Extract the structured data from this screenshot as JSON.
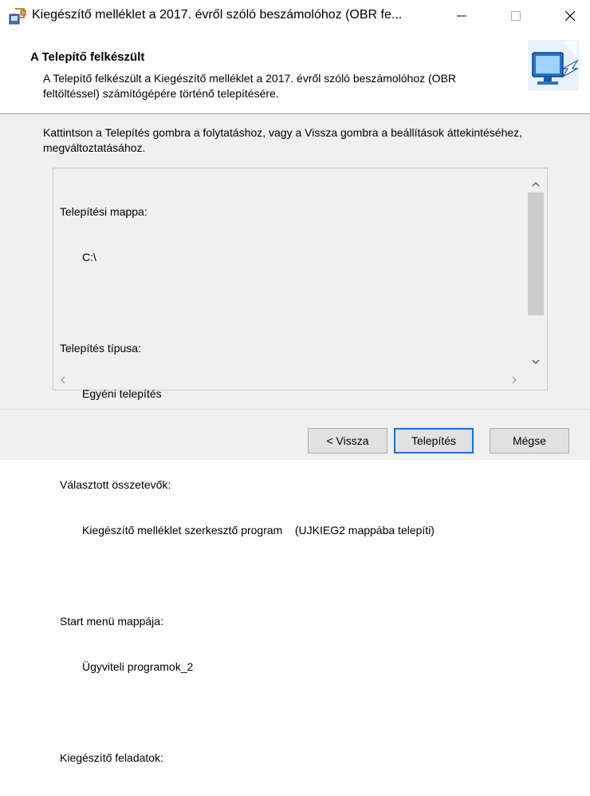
{
  "window": {
    "title": "Kiegészítő melléklet a 2017. évről szóló beszámolóhoz (OBR fe...",
    "controls": {
      "minimize": "—",
      "maximize": "☐",
      "close": "✕"
    }
  },
  "header": {
    "title": "A Telepítő felkészült",
    "description": "A Telepítő felkészült a Kiegészítő melléklet a 2017. évről szóló beszámolóhoz (OBR feltöltéssel) számítógépére történő telepítésére."
  },
  "instructions": "Kattintson a Telepítés gombra a folytatáshoz, vagy a Vissza gombra a beállítások áttekintéséhez, megváltoztatásához.",
  "summary": {
    "sections": [
      {
        "label": "Telepítési mappa:",
        "value": "C:\\"
      },
      {
        "label": "Telepítés típusa:",
        "value": "Egyéni telepítés"
      },
      {
        "label": "Választott összetevők:",
        "value": "Kiegészítő melléklet szerkesztő program    (UJKIEG2 mappába telepíti)"
      },
      {
        "label": "Start menü mappája:",
        "value": "Ügyviteli programok_2"
      },
      {
        "label": "Kiegészítő feladatok:",
        "value": ""
      }
    ]
  },
  "buttons": {
    "back": "< Vissza",
    "install": "Telepítés",
    "cancel": "Mégse"
  },
  "colors": {
    "accent": "#0078d7",
    "background": "#f0f0f0",
    "header_bg": "#ffffff"
  }
}
